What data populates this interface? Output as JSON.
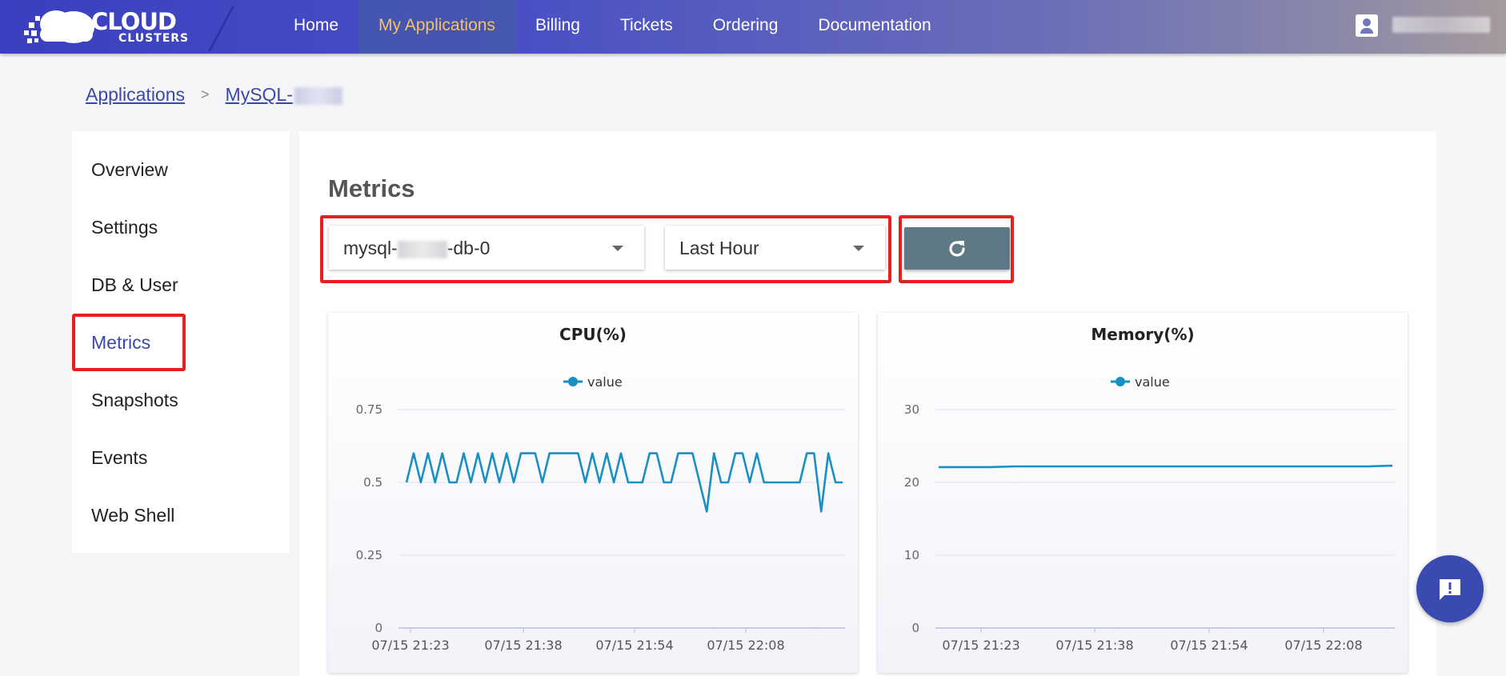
{
  "nav": {
    "logo_line1": "CLOUD",
    "logo_line2": "CLUSTERS",
    "items": [
      {
        "label": "Home",
        "active": false
      },
      {
        "label": "My Applications",
        "active": true
      },
      {
        "label": "Billing",
        "active": false
      },
      {
        "label": "Tickets",
        "active": false
      },
      {
        "label": "Ordering",
        "active": false
      },
      {
        "label": "Documentation",
        "active": false
      }
    ]
  },
  "breadcrumb": {
    "root": "Applications",
    "separator": ">",
    "current": "MySQL-"
  },
  "sidebar": {
    "items": [
      {
        "label": "Overview"
      },
      {
        "label": "Settings"
      },
      {
        "label": "DB & User"
      },
      {
        "label": "Metrics",
        "active": true
      },
      {
        "label": "Snapshots"
      },
      {
        "label": "Events"
      },
      {
        "label": "Web Shell"
      }
    ]
  },
  "main": {
    "title": "Metrics",
    "pod_select": {
      "prefix": "mysql-",
      "suffix": "-db-0"
    },
    "range_select": {
      "value": "Last Hour"
    }
  },
  "colors": {
    "accent": "#3a49a8",
    "series": "#1a8fc4",
    "highlight": "#e62020",
    "refresh": "#5f7886"
  },
  "chart_data": [
    {
      "type": "line",
      "title": "CPU(%)",
      "legend": "value",
      "legend_position": "top-center",
      "ylim": [
        0,
        0.75
      ],
      "yticks": [
        "0",
        "0.25",
        "0.5",
        "0.75"
      ],
      "xticks": [
        "07/15 21:23",
        "07/15 21:38",
        "07/15 21:54",
        "07/15 22:08"
      ],
      "grid": true,
      "values": [
        0.5,
        0.6,
        0.5,
        0.6,
        0.5,
        0.6,
        0.5,
        0.5,
        0.6,
        0.5,
        0.6,
        0.5,
        0.6,
        0.5,
        0.6,
        0.5,
        0.6,
        0.6,
        0.6,
        0.5,
        0.6,
        0.6,
        0.6,
        0.6,
        0.6,
        0.5,
        0.6,
        0.5,
        0.6,
        0.5,
        0.6,
        0.5,
        0.5,
        0.5,
        0.6,
        0.6,
        0.5,
        0.5,
        0.6,
        0.6,
        0.6,
        0.5,
        0.4,
        0.6,
        0.5,
        0.5,
        0.6,
        0.6,
        0.5,
        0.6,
        0.5,
        0.5,
        0.5,
        0.5,
        0.5,
        0.5,
        0.6,
        0.6,
        0.4,
        0.6,
        0.5,
        0.5
      ]
    },
    {
      "type": "line",
      "title": "Memory(%)",
      "legend": "value",
      "legend_position": "top-center",
      "ylim": [
        0,
        30
      ],
      "yticks": [
        "0",
        "10",
        "20",
        "30"
      ],
      "xticks": [
        "07/15 21:23",
        "07/15 21:38",
        "07/15 21:54",
        "07/15 22:08"
      ],
      "grid": true,
      "values": [
        22.1,
        22.1,
        22.1,
        22.2,
        22.2,
        22.2,
        22.2,
        22.2,
        22.2,
        22.2,
        22.2,
        22.2,
        22.2,
        22.2,
        22.2,
        22.2,
        22.2,
        22.2,
        22.3
      ]
    }
  ]
}
